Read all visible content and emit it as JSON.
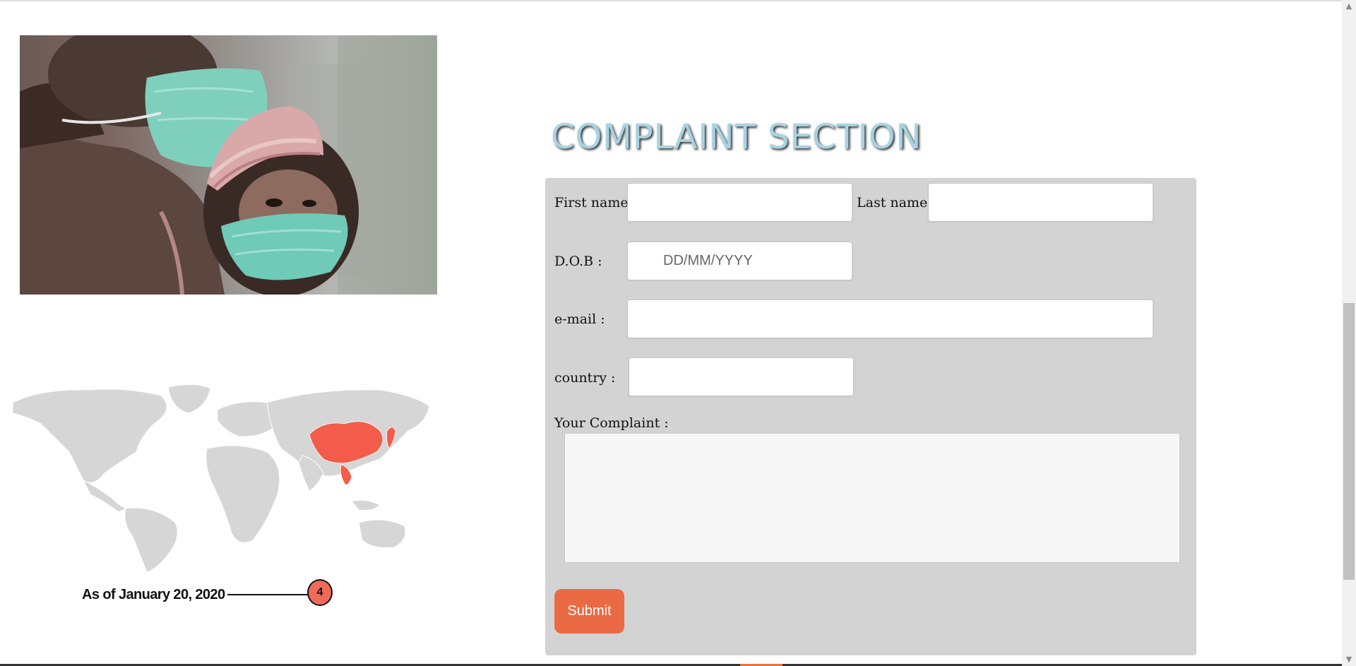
{
  "photo": {
    "icon": "photo-masked-people"
  },
  "map": {
    "icon": "world-map-icon",
    "highlight_color": "#f35c4a",
    "base_color": "#d6d6d6",
    "timeline": {
      "label": "As of January 20, 2020",
      "count": "4"
    }
  },
  "form": {
    "heading": "COMPLAINT SECTION",
    "first_name_label": "First name:",
    "last_name_label": "Last name:",
    "dob_label": "D.O.B :",
    "dob_placeholder": "DD/MM/YYYY",
    "email_label": "e-mail :",
    "country_label": "country :",
    "complaint_label": "Your Complaint :",
    "first_name_value": "",
    "last_name_value": "",
    "email_value": "",
    "country_value": "",
    "complaint_value": "",
    "submit_label": "Submit"
  },
  "colors": {
    "heading": "#a7d3e2",
    "panel": "#d3d3d3",
    "submit": "#ea6a44"
  }
}
